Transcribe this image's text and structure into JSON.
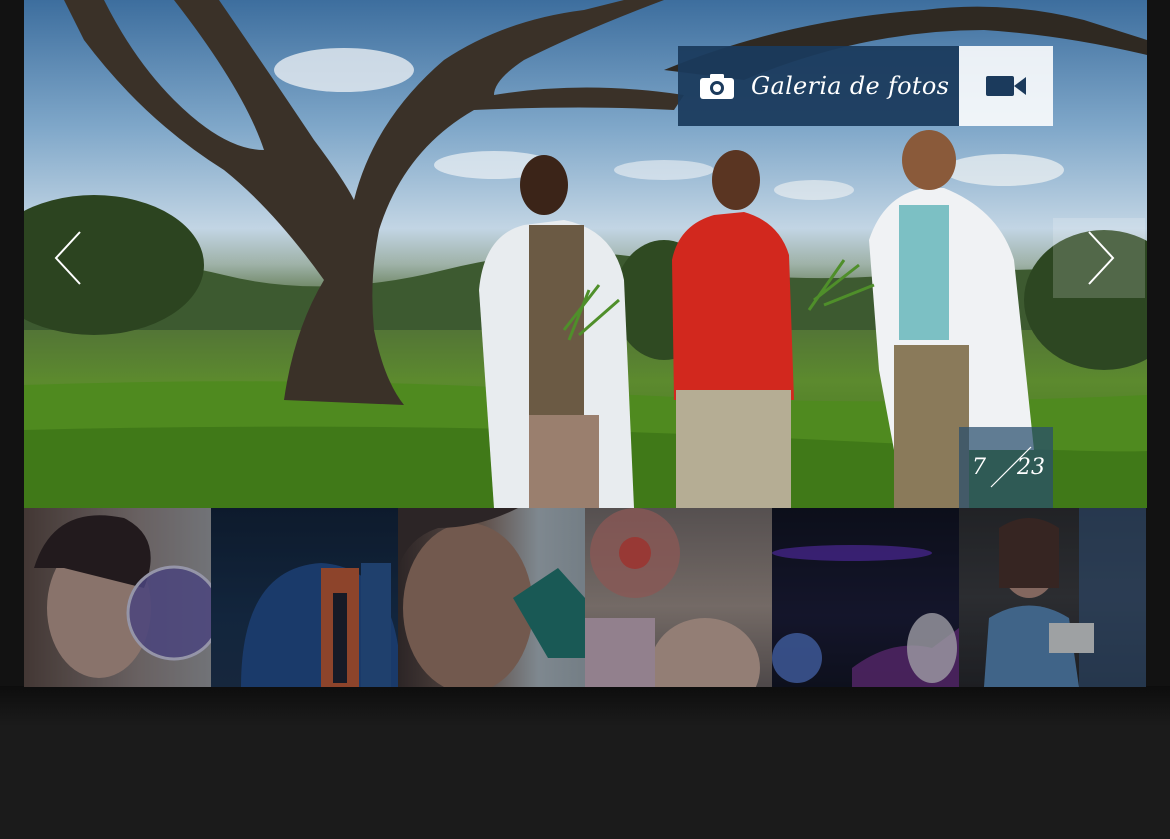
{
  "gallery": {
    "title": "Galeria de fotos",
    "photo_icon": "camera-icon",
    "video_icon": "video-camera-icon",
    "prev_icon": "chevron-left-icon",
    "next_icon": "chevron-right-icon",
    "counter": {
      "current": "7",
      "total": "23"
    },
    "accent_color": "#1b3a5c"
  },
  "thumbnails": [
    {
      "name": "thumbnail-scientist-petri-dish"
    },
    {
      "name": "thumbnail-observatory"
    },
    {
      "name": "thumbnail-microscope"
    },
    {
      "name": "thumbnail-lab-samples"
    },
    {
      "name": "thumbnail-uv-light"
    },
    {
      "name": "thumbnail-server-room"
    }
  ]
}
